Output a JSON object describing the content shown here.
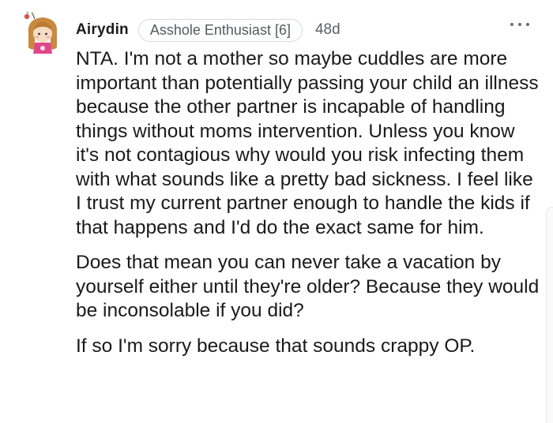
{
  "comment": {
    "username": "Airydin",
    "flair": "Asshole Enthusiast [6]",
    "age": "48d",
    "more_icon": "more-horizontal-icon",
    "avatar_icon": "user-avatar-icon",
    "paragraphs": [
      "NTA. I'm not a mother so maybe cuddles are more important than potentially passing your child an illness because the other partner is incapable of handling things without moms intervention. Unless you know it's not contagious why would you risk infecting them with what sounds like a pretty bad sickness. I feel like I trust my current partner enough to handle the kids if that happens and I'd do the exact same for him.",
      "Does that mean you can never take a vacation by yourself either until they're older? Because they would be inconsolable if you did?",
      "If so I'm sorry because that sounds crappy OP."
    ]
  }
}
